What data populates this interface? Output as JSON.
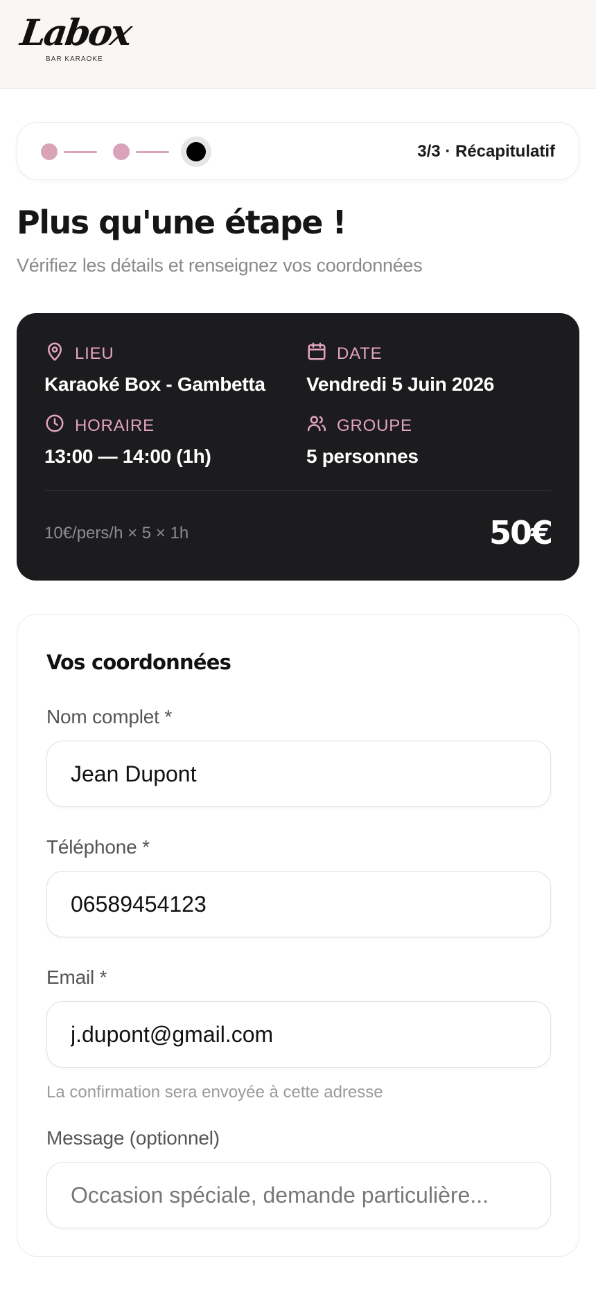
{
  "brand": {
    "logo_text": "Labox",
    "tagline": "BAR KARAOKE"
  },
  "stepper": {
    "current": 3,
    "total": 3,
    "label": "3/3 · Récapitulatif",
    "colors": {
      "done": "#d9a3b8",
      "active": "#000000"
    }
  },
  "page": {
    "title": "Plus qu'une étape !",
    "subtitle": "Vérifiez les détails et renseignez vos coordonnées"
  },
  "summary": {
    "lieu_label": "LIEU",
    "lieu_value": "Karaoké Box - Gambetta",
    "date_label": "DATE",
    "date_value": "Vendredi 5 Juin 2026",
    "horaire_label": "HORAIRE",
    "horaire_value": "13:00 — 14:00 (1h)",
    "groupe_label": "GROUPE",
    "groupe_value": "5 personnes",
    "formula": "10€/pers/h × 5 × 1h",
    "total": "50€",
    "icons": {
      "lieu": "map-pin-icon",
      "date": "calendar-icon",
      "horaire": "clock-icon",
      "groupe": "users-icon"
    },
    "accent": "#e4a5bd"
  },
  "form": {
    "title": "Vos coordonnées",
    "name_label": "Nom complet *",
    "name_value": "Jean Dupont",
    "phone_label": "Téléphone *",
    "phone_value": "06589454123",
    "email_label": "Email *",
    "email_value": "j.dupont@gmail.com",
    "email_hint": "La confirmation sera envoyée à cette adresse",
    "message_label": "Message (optionnel)",
    "message_placeholder": "Occasion spéciale, demande particulière..."
  }
}
